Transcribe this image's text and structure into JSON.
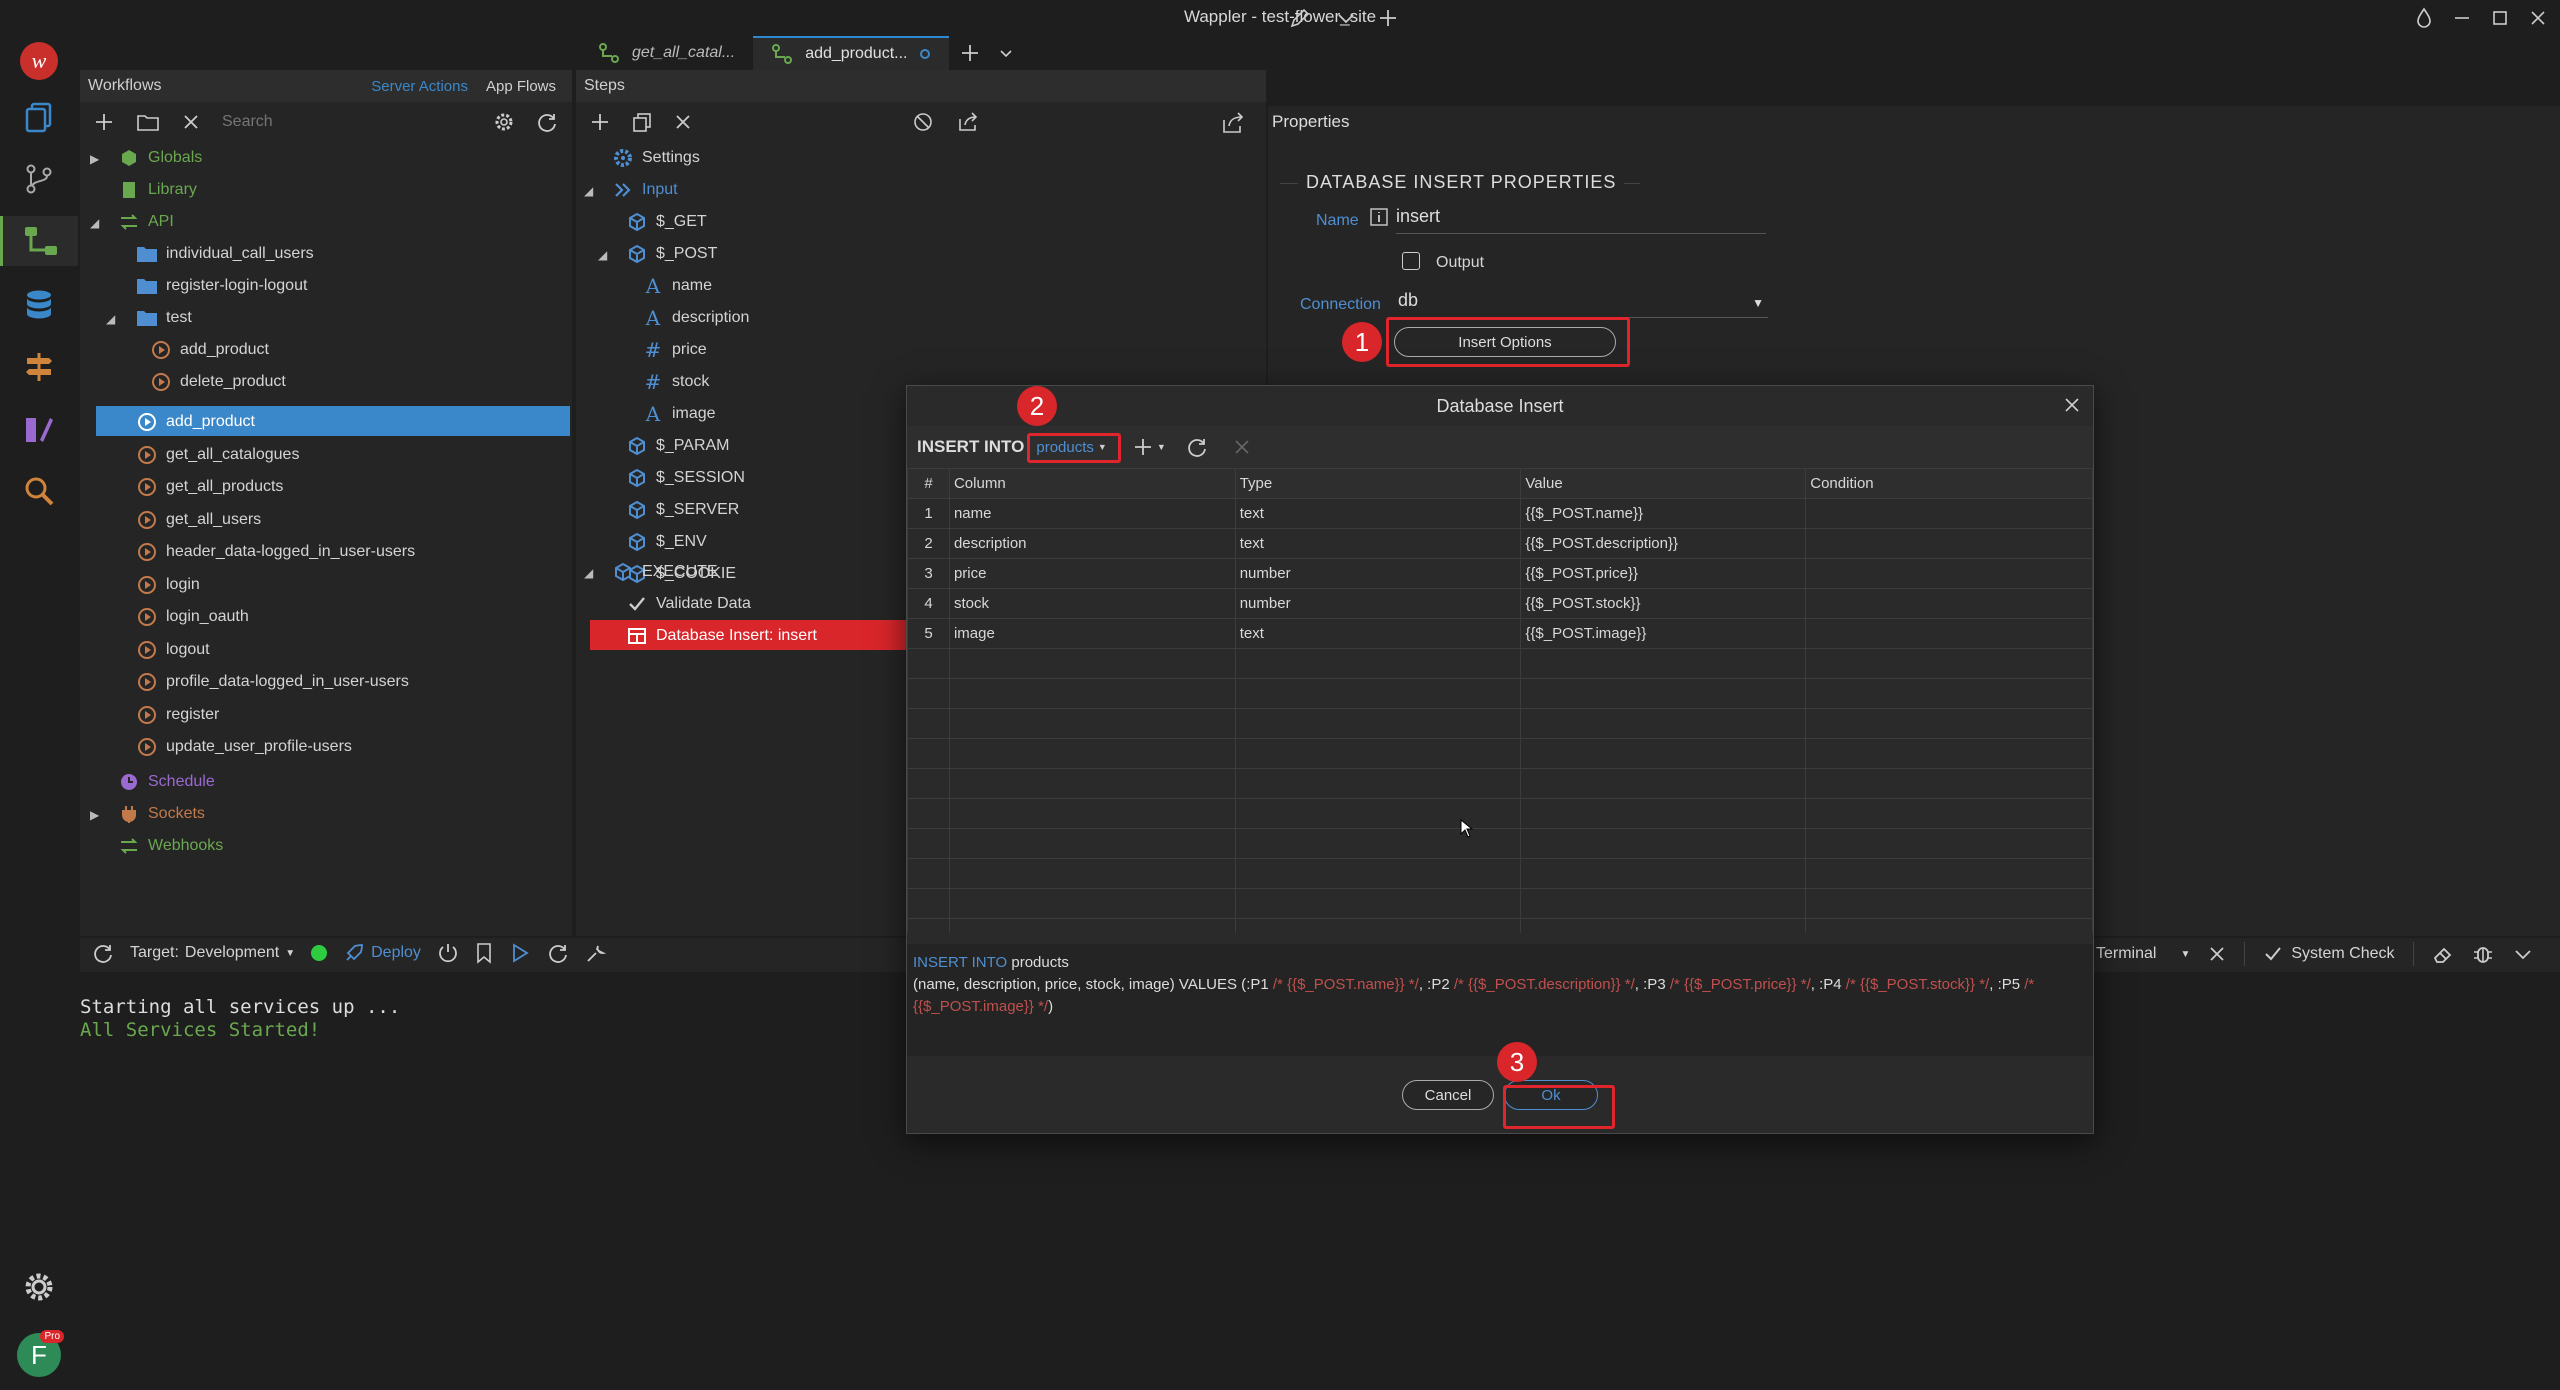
{
  "window": {
    "title": "Wappler - test-flower_site"
  },
  "tabs": [
    {
      "label": "get_all_catal..."
    },
    {
      "label": "add_product..."
    }
  ],
  "workflows": {
    "title": "Workflows",
    "tabs": [
      "Server Actions",
      "App Flows"
    ],
    "search_placeholder": "Search",
    "tree": {
      "globals": "Globals",
      "library": "Library",
      "api": "API",
      "folders": [
        "individual_call_users",
        "register-login-logout"
      ],
      "test": "test",
      "test_items": [
        "add_product",
        "delete_product"
      ],
      "items": [
        "add_product",
        "get_all_catalogues",
        "get_all_products",
        "get_all_users",
        "header_data-logged_in_user-users",
        "login",
        "login_oauth",
        "logout",
        "profile_data-logged_in_user-users",
        "register",
        "update_user_profile-users"
      ],
      "schedule": "Schedule",
      "sockets": "Sockets",
      "webhooks": "Webhooks"
    }
  },
  "steps": {
    "title": "Steps",
    "settings": "Settings",
    "input": "Input",
    "get": "$_GET",
    "post": "$_POST",
    "post_fields": [
      {
        "icon": "text-icon",
        "label": "name"
      },
      {
        "icon": "text-icon",
        "label": "description"
      },
      {
        "icon": "hash-icon",
        "label": "price"
      },
      {
        "icon": "hash-icon",
        "label": "stock"
      },
      {
        "icon": "text-icon",
        "label": "image"
      }
    ],
    "others": [
      "$_PARAM",
      "$_SESSION",
      "$_SERVER",
      "$_ENV",
      "$_COOKIE"
    ],
    "execute": "EXECUTE",
    "validate": "Validate Data",
    "db_insert": "Database Insert: insert"
  },
  "properties": {
    "title": "Properties",
    "section": "DATABASE INSERT PROPERTIES",
    "name_label": "Name",
    "name_value": "insert",
    "output_label": "Output",
    "connection_label": "Connection",
    "connection_value": "db",
    "insert_options": "Insert Options"
  },
  "dialog": {
    "title": "Database Insert",
    "insert_into": "INSERT INTO",
    "table": "products",
    "columns": [
      "#",
      "Column",
      "Type",
      "Value",
      "Condition"
    ],
    "rows": [
      {
        "n": "1",
        "column": "name",
        "type": "text",
        "value": "{{$_POST.name}}"
      },
      {
        "n": "2",
        "column": "description",
        "type": "text",
        "value": "{{$_POST.description}}"
      },
      {
        "n": "3",
        "column": "price",
        "type": "number",
        "value": "{{$_POST.price}}"
      },
      {
        "n": "4",
        "column": "stock",
        "type": "number",
        "value": "{{$_POST.stock}}"
      },
      {
        "n": "5",
        "column": "image",
        "type": "text",
        "value": "{{$_POST.image}}"
      }
    ],
    "sql_line1_kw": "INSERT INTO",
    "sql_line1_table": "products",
    "sql_cols": "(name, description, price, stock, image) VALUES (",
    "sql_params": [
      {
        "p": ":P1",
        "c": "/* {{$_POST.name}} */"
      },
      {
        "p": ":P2",
        "c": "/* {{$_POST.description}} */"
      },
      {
        "p": ":P3",
        "c": "/* {{$_POST.price}} */"
      },
      {
        "p": ":P4",
        "c": "/* {{$_POST.stock}} */"
      },
      {
        "p": ":P5",
        "c": "/* {{$_POST.image}} */"
      }
    ],
    "sql_end": ")",
    "cancel": "Cancel",
    "ok": "Ok"
  },
  "bottom": {
    "target_label": "Target:",
    "target_value": "Development",
    "deploy": "Deploy",
    "terminal": "Terminal",
    "system_check": "System Check",
    "log": [
      "Starting all services up ...",
      "All Services Started!"
    ]
  },
  "annotations": [
    "1",
    "2",
    "3"
  ],
  "account": {
    "initial": "F",
    "badge": "Pro"
  },
  "colors": {
    "accent": "#2e87d0",
    "selected": "#3a88c9",
    "danger": "#d9262b",
    "green": "#6aa84f"
  }
}
